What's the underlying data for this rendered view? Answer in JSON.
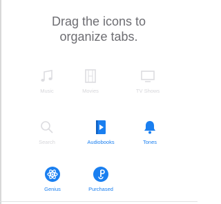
{
  "header": {
    "line1": "Drag the icons to",
    "line2": "organize tabs."
  },
  "colors": {
    "accent": "#1a7ff0",
    "disabled": "#dcdce0",
    "text": "#6d6d72"
  },
  "tiles": [
    {
      "label": "Music",
      "icon": "music-note-icon",
      "state": "disabled"
    },
    {
      "label": "Movies",
      "icon": "film-strip-icon",
      "state": "disabled"
    },
    {
      "label": "TV Shows",
      "icon": "tv-icon",
      "state": "disabled"
    },
    {
      "label": "Search",
      "icon": "search-icon",
      "state": "disabled"
    },
    {
      "label": "Audiobooks",
      "icon": "audiobook-icon",
      "state": "active"
    },
    {
      "label": "Tones",
      "icon": "bell-icon",
      "state": "active"
    },
    {
      "label": "Genius",
      "icon": "genius-atom-icon",
      "state": "active"
    },
    {
      "label": "Purchased",
      "icon": "purchased-icon",
      "state": "active"
    }
  ]
}
